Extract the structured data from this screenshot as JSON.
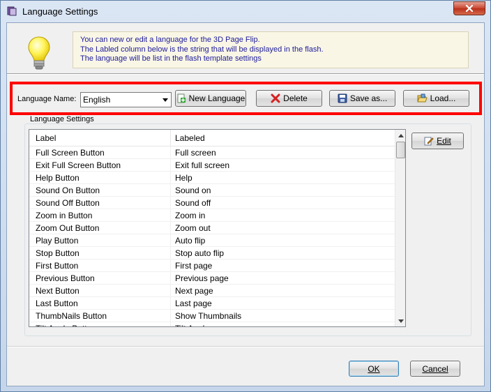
{
  "window": {
    "title": "Language Settings"
  },
  "info": {
    "lines": [
      "You can new or edit  a language for the 3D Page Flip.",
      "The Labled column below is the string that will be displayed in the flash.",
      "The language will be list in the flash template settings"
    ]
  },
  "toolbar": {
    "language_name_label": "Language Name:",
    "language_selected": "English",
    "new_language_label": "New Language",
    "delete_label": "Delete",
    "save_as_label": "Save as...",
    "load_label": "Load..."
  },
  "settings": {
    "group_label": "Language Settings",
    "columns": [
      "Label",
      "Labeled"
    ],
    "rows": [
      [
        "Full Screen Button",
        "Full screen"
      ],
      [
        "Exit Full Screen Button",
        "Exit full screen"
      ],
      [
        "Help Button",
        "Help"
      ],
      [
        "Sound On Button",
        "Sound on"
      ],
      [
        "Sound Off Button",
        "Sound off"
      ],
      [
        "Zoom in Button",
        "Zoom in"
      ],
      [
        "Zoom Out Button",
        "Zoom out"
      ],
      [
        "Play Button",
        "Auto flip"
      ],
      [
        "Stop Button",
        "Stop auto flip"
      ],
      [
        "First Button",
        "First page"
      ],
      [
        "Previous Button",
        "Previous page"
      ],
      [
        "Next Button",
        "Next page"
      ],
      [
        "Last Button",
        "Last page"
      ],
      [
        "ThumbNails Button",
        "Show Thumbnails"
      ],
      [
        "Tilt Angle Button",
        "Tilt Angle"
      ]
    ],
    "edit_label": "Edit"
  },
  "footer": {
    "ok_label": "OK",
    "cancel_label": "Cancel"
  }
}
